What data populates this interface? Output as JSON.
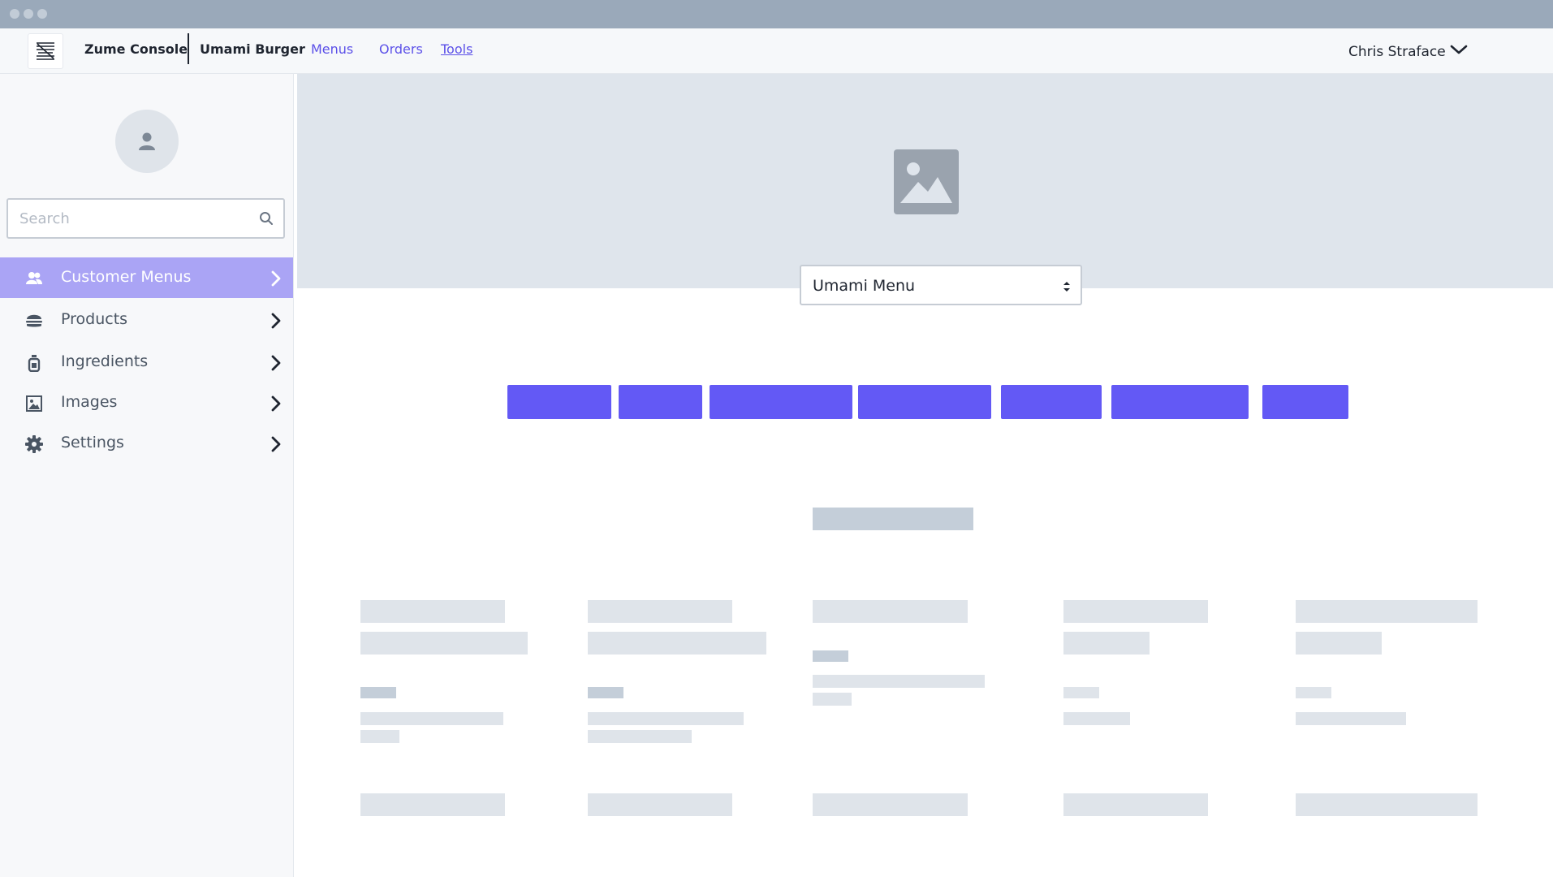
{
  "window": {
    "controls": [
      "close",
      "minimize",
      "maximize"
    ]
  },
  "topnav": {
    "logo_icon": "zume-logo-icon",
    "brand": "Zume Console",
    "store": "Umami Burger",
    "links": [
      {
        "label": "Menus"
      },
      {
        "label": "Orders"
      },
      {
        "label": "Tools",
        "active": true
      }
    ],
    "user": {
      "name": "Chris Straface",
      "icon": "chevron-down-icon"
    }
  },
  "sidebar": {
    "avatar_icon": "user-icon",
    "search": {
      "placeholder": "Search",
      "value": "",
      "icon": "search-icon"
    },
    "items": [
      {
        "label": "Customer Menus",
        "icon": "users-icon",
        "active": true
      },
      {
        "label": "Products",
        "icon": "burger-icon"
      },
      {
        "label": "Ingredients",
        "icon": "bottle-icon"
      },
      {
        "label": "Images",
        "icon": "image-icon"
      },
      {
        "label": "Settings",
        "icon": "gear-icon"
      }
    ]
  },
  "main": {
    "hero_icon": "image-placeholder-icon",
    "menu_select": {
      "value": "Umami Menu"
    },
    "category_tabs_count": 7,
    "accent_color": "#6359f5",
    "active_nav_color": "#aaa4f5"
  }
}
